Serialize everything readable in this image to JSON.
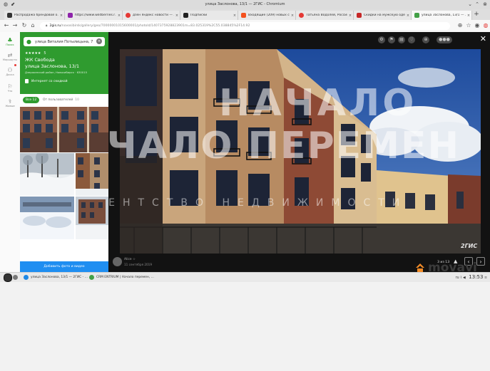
{
  "window": {
    "title": "улица Заслонова, 13/1 — 2ГИС - Chromium"
  },
  "tabs": [
    {
      "label": "Распродажа брендовой о…",
      "color": "#333333"
    },
    {
      "label": "https://www.wildberries.r…",
      "color": "#8e24aa"
    },
    {
      "label": "дзен яндекс новости — …",
      "color": "#e53935"
    },
    {
      "label": "Подписки",
      "color": "#222222"
    },
    {
      "label": "Входящие (209) новых со…",
      "color": "#f4511e"
    },
    {
      "label": "Татьяна Водолей, Россия, …",
      "color": "#e53935"
    },
    {
      "label": "Скидки на мужскую одеж…",
      "color": "#c62828"
    },
    {
      "label": "улица Заслонова, 13/1 — …",
      "color": "#43a047"
    }
  ],
  "address": {
    "host": "2gis.ru",
    "path": "/novosibirsk/gallery/geo/70000001015600001/photoId/1407375928823901m=83.025319%2C55.038845%2F14.92"
  },
  "rail": [
    {
      "icon": "♣",
      "label": "Поиск"
    },
    {
      "icon": "⇄",
      "label": "Маршруты"
    },
    {
      "icon": "⚇",
      "label": "Доска"
    },
    {
      "icon": "⚐",
      "label": "Что"
    },
    {
      "icon": "⚕",
      "label": "Живые"
    }
  ],
  "search": {
    "value": "улица Виталия Потылицына, 7"
  },
  "org": {
    "stars": "★★★★★",
    "rating_count": "5",
    "name": "ЖК Свобода",
    "address": "улица Заслонова, 13/1",
    "district": "Дзержинский район, Новосибирск · 630015",
    "discount": "Интернет со скидкой"
  },
  "filters": {
    "all_label": "Все",
    "all_count": "12",
    "user_label": "От пользователей",
    "user_count": "10"
  },
  "add_photo_label": "Добавить фото и видео",
  "viewer": {
    "watermark_main": "НАЧАЛО ПЕРЕМЕН",
    "watermark_sub": "АГЕНТСТВО НЕДВИЖИМОСТИ",
    "author": "Alice ☆",
    "date": "11 сентября 2019",
    "counter": "3 из 13",
    "badge": "2ГИС",
    "close_icon": "close-icon"
  },
  "taskbar": {
    "tasks": [
      {
        "label": "улица Заслонова, 13/1 — 2ГИС - …",
        "color": "#1e88e5"
      },
      {
        "label": "CRM ENTRIUM | Начало перемен, …",
        "color": "#43a047"
      }
    ],
    "tray": "ru",
    "clock": "13:53",
    "brand": "movavi"
  }
}
